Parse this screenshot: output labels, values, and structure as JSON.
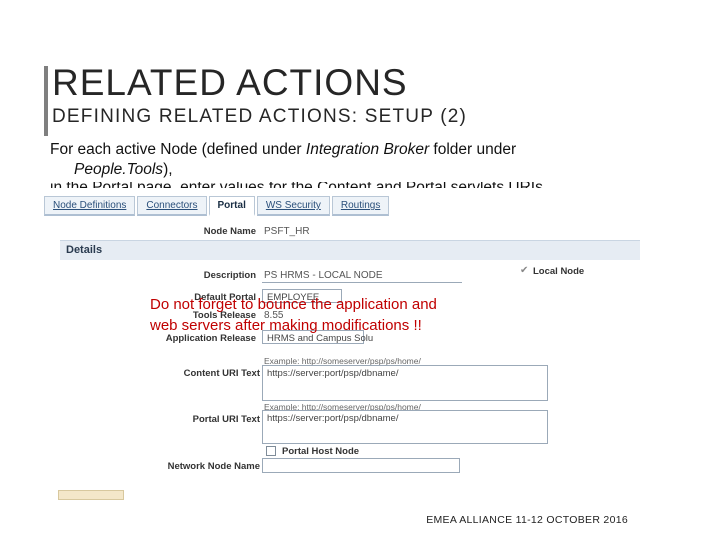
{
  "slide": {
    "title": "RELATED ACTIONS",
    "subtitle": "DEFINING RELATED ACTIONS: SETUP (2)",
    "intro": {
      "line1_a": "For each active Node (defined under ",
      "line1_b": "Integration Broker",
      "line1_c": " folder under",
      "line2_a": "People.Tools",
      "line2_b": "),",
      "line3": "in the Portal page, enter values for the Content and Portal servlets URIs"
    },
    "warning": {
      "line1": "Do not forget to bounce the application and",
      "line2": "web servers after making modifications !!"
    },
    "footer": "EMEA ALLIANCE  11-12 OCTOBER 2016"
  },
  "screenshot": {
    "tabs": [
      {
        "label": "Node Definitions",
        "active": false
      },
      {
        "label": "Connectors",
        "active": false
      },
      {
        "label": "Portal",
        "active": true
      },
      {
        "label": "WS Security",
        "active": false
      },
      {
        "label": "Routings",
        "active": false
      }
    ],
    "node_name_label": "Node Name",
    "node_name_value": "PSFT_HR",
    "details_label": "Details",
    "description_label": "Description",
    "description_value": "PS HRMS - LOCAL NODE",
    "local_node_label": "Local Node",
    "default_portal_label": "Default Portal",
    "default_portal_value": "EMPLOYEE",
    "tools_release_label": "Tools Release",
    "tools_release_value": "8.55",
    "application_release_label": "Application Release",
    "application_release_value": "HRMS and Campus Solu",
    "content_example": "Example: http://someserver/psp/ps/home/",
    "content_uri_label": "Content URI Text",
    "content_uri_value": "https://server:port/psp/dbname/",
    "portal_example": "Example: http://someserver/psp/ps/home/",
    "portal_uri_label": "Portal URI Text",
    "portal_uri_value": "https://server:port/psp/dbname/",
    "portal_host_node_label": "Portal Host Node",
    "network_node_label": "Network Node Name",
    "network_node_value": ""
  },
  "colors": {
    "warning": "#c00000",
    "accent_bar": "#7f7f7f",
    "tab_link": "#2a4f7a"
  }
}
